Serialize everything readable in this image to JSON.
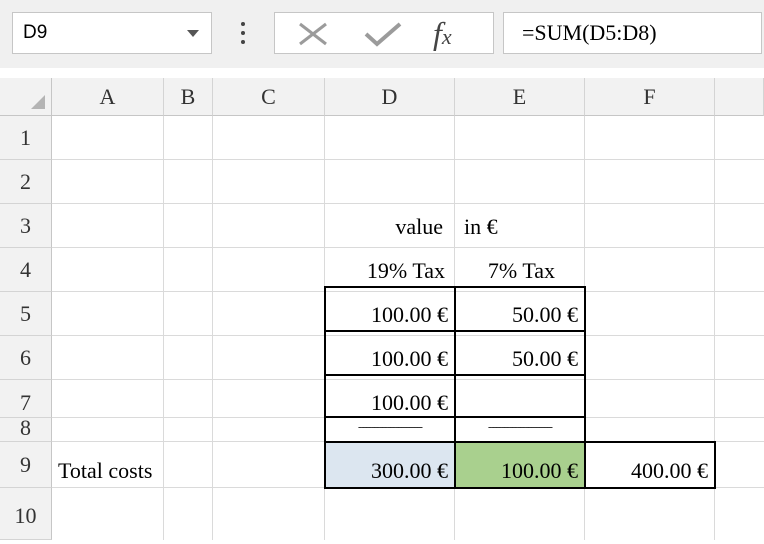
{
  "name_box": {
    "value": "D9"
  },
  "formula_bar": {
    "cancel_icon": "x-icon",
    "enter_icon": "checkmark-icon",
    "function_icon": "fx-icon",
    "formula": "=SUM(D5:D8)"
  },
  "columns": [
    "A",
    "B",
    "C",
    "D",
    "E",
    "F"
  ],
  "rows": [
    "1",
    "2",
    "3",
    "4",
    "5",
    "6",
    "7",
    "8",
    "9",
    "10"
  ],
  "cells": {
    "D3": "value",
    "E3": "in €",
    "D4": "19% Tax",
    "E4": "7% Tax",
    "D5": "100.00 €",
    "E5": "50.00 €",
    "D6": "100.00 €",
    "E6": "50.00 €",
    "D7": "100.00 €",
    "D8": "------------------------",
    "E8": "------------------------",
    "A9": "Total costs",
    "D9": "300.00 €",
    "E9": "100.00 €",
    "F9": "400.00 €"
  },
  "colors": {
    "selected_cell_fill": "#dce6f0",
    "e9_fill": "#a9d08e",
    "grid_line": "#dadada",
    "header_fill": "#f2f2f2"
  }
}
